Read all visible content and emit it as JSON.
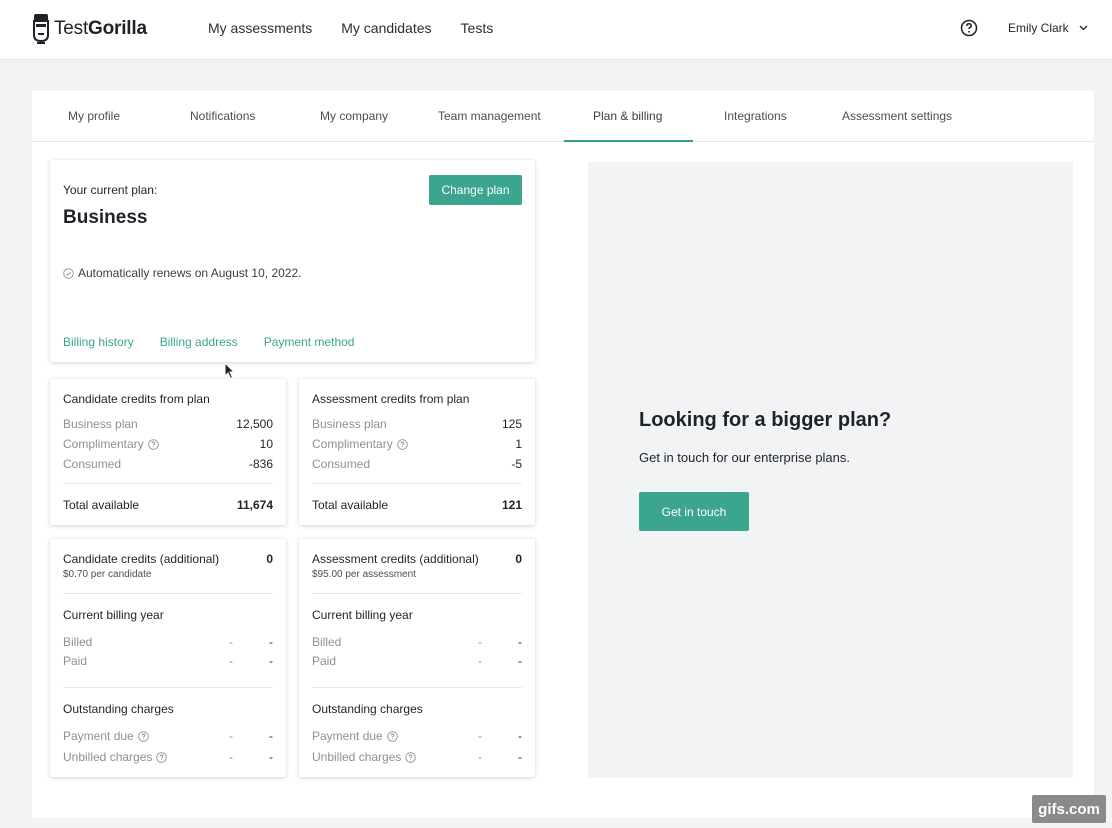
{
  "brand": {
    "name_part1": "Test",
    "name_part2": "Gorilla"
  },
  "nav": {
    "items": [
      "My assessments",
      "My candidates",
      "Tests"
    ]
  },
  "user": {
    "name": "Emily Clark"
  },
  "tabs": [
    "My profile",
    "Notifications",
    "My company",
    "Team management",
    "Plan & billing",
    "Integrations",
    "Assessment settings"
  ],
  "active_tab": "Plan & billing",
  "plan": {
    "label": "Your current plan:",
    "name": "Business",
    "change_button": "Change plan",
    "renews": "Automatically renews on August 10, 2022.",
    "links": [
      "Billing history",
      "Billing address",
      "Payment method"
    ]
  },
  "candidate_credits": {
    "title": "Candidate credits from plan",
    "rows": [
      {
        "label": "Business plan",
        "value": "12,500"
      },
      {
        "label": "Complimentary",
        "value": "10"
      },
      {
        "label": "Consumed",
        "value": "-836"
      }
    ],
    "total_label": "Total available",
    "total_value": "11,674"
  },
  "assessment_credits": {
    "title": "Assessment credits from plan",
    "rows": [
      {
        "label": "Business plan",
        "value": "125"
      },
      {
        "label": "Complimentary",
        "value": "1"
      },
      {
        "label": "Consumed",
        "value": "-5"
      }
    ],
    "total_label": "Total available",
    "total_value": "121"
  },
  "candidate_additional": {
    "title": "Candidate credits (additional)",
    "value": "0",
    "price": "$0.70 per candidate",
    "billing_year": "Current billing year",
    "billed": "Billed",
    "paid": "Paid",
    "outstanding": "Outstanding charges",
    "payment_due": "Payment due",
    "unbilled": "Unbilled charges",
    "dash": "-"
  },
  "assessment_additional": {
    "title": "Assessment credits (additional)",
    "value": "0",
    "price": "$95.00 per assessment",
    "billing_year": "Current billing year",
    "billed": "Billed",
    "paid": "Paid",
    "outstanding": "Outstanding charges",
    "payment_due": "Payment due",
    "unbilled": "Unbilled charges",
    "dash": "-"
  },
  "promo": {
    "title": "Looking for a bigger plan?",
    "text": "Get in touch for our enterprise plans.",
    "button": "Get in touch"
  },
  "watermark": "gifs.com",
  "colors": {
    "accent": "#3ba58f",
    "background": "#f2f3f5"
  }
}
